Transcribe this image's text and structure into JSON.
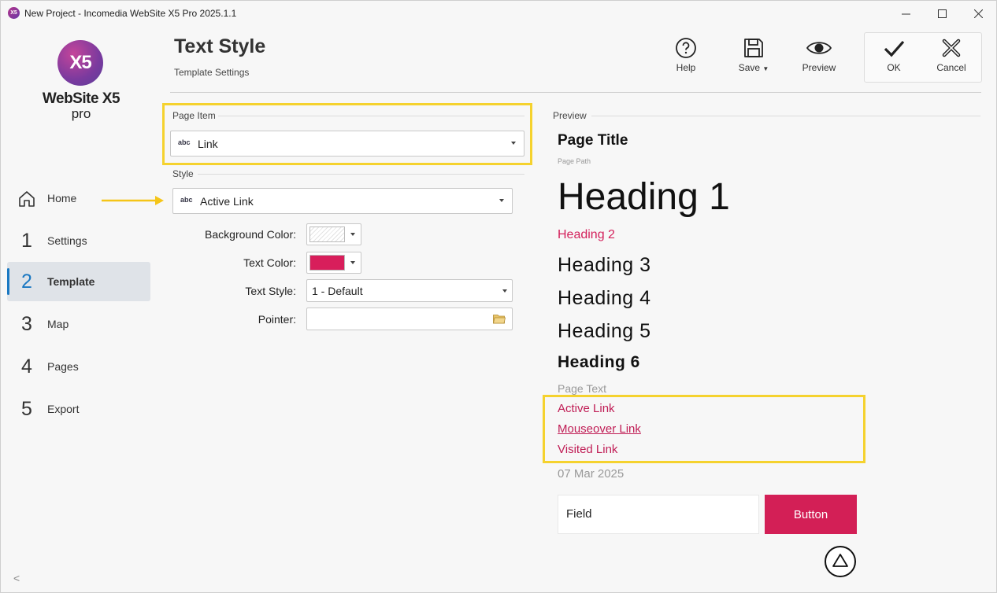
{
  "window": {
    "title": "New Project - Incomedia WebSite X5 Pro 2025.1.1",
    "app_icon": "X5"
  },
  "sidebar": {
    "logo": {
      "mark": "X5",
      "name": "WebSite X5",
      "edition": "pro"
    },
    "items": [
      {
        "num": "",
        "label": "Home",
        "icon": "home-icon"
      },
      {
        "num": "1",
        "label": "Settings"
      },
      {
        "num": "2",
        "label": "Template",
        "active": true
      },
      {
        "num": "3",
        "label": "Map"
      },
      {
        "num": "4",
        "label": "Pages"
      },
      {
        "num": "5",
        "label": "Export"
      }
    ],
    "collapse_glyph": "<"
  },
  "header": {
    "title": "Text Style",
    "subtitle": "Template Settings",
    "tools": {
      "help": "Help",
      "save": "Save",
      "preview": "Preview",
      "ok": "OK",
      "cancel": "Cancel"
    }
  },
  "form": {
    "page_item_label": "Page Item",
    "page_item_value": "Link",
    "style_label": "Style",
    "style_value": "Active Link",
    "dd_icon": "abc",
    "background_color_label": "Background Color:",
    "text_color_label": "Text Color:",
    "text_color": "#d81e5b",
    "text_style_label": "Text Style:",
    "text_style_value": "1 - Default",
    "pointer_label": "Pointer:",
    "pointer_value": ""
  },
  "preview": {
    "label": "Preview",
    "page_title": "Page Title",
    "page_path": "Page Path",
    "h1": "Heading 1",
    "h2": "Heading 2",
    "h3": "Heading 3",
    "h4": "Heading 4",
    "h5": "Heading 5",
    "h6": "Heading 6",
    "page_text": "Page Text",
    "active_link": "Active Link",
    "mouseover_link": "Mouseover Link",
    "visited_link": "Visited Link",
    "date": "07 Mar 2025",
    "field": "Field",
    "button": "Button"
  },
  "colors": {
    "accent": "#d31f56",
    "highlight": "#f5d22e",
    "nav_active": "#1a78c2"
  }
}
